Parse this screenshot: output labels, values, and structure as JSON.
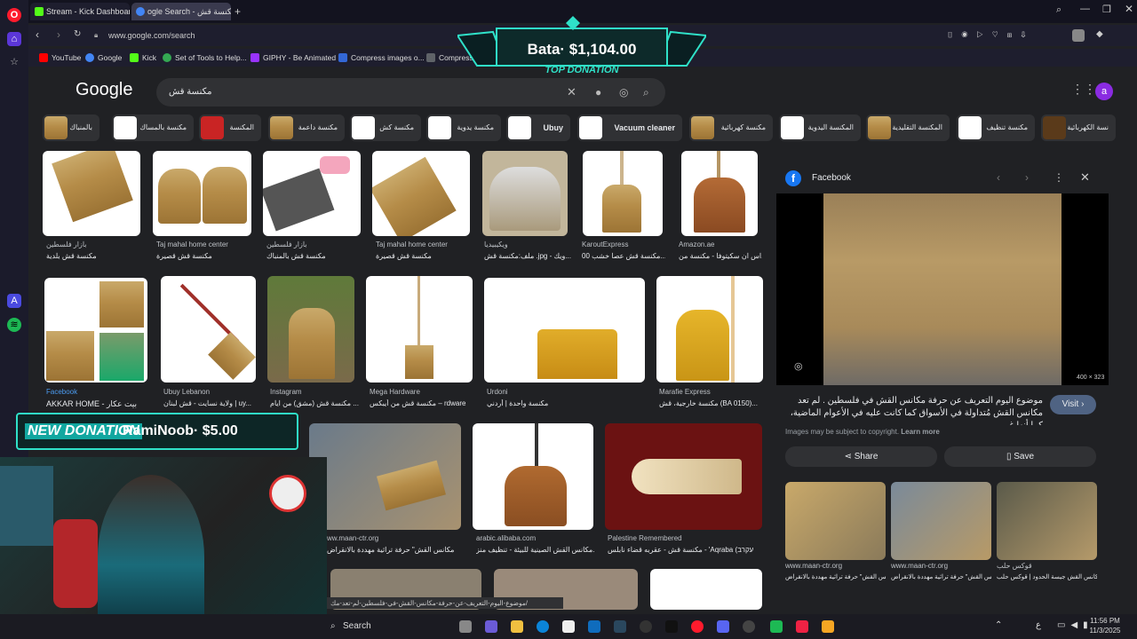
{
  "browser": {
    "tabs": [
      {
        "label": "Stream - Kick Dashboard",
        "color": "#53fc18"
      },
      {
        "label": "ogle Search - مكنسة قش",
        "color": "#4285f4"
      }
    ],
    "url": "www.google.com/search",
    "bookmarks": [
      {
        "label": "YouTube",
        "color": "#ff0000"
      },
      {
        "label": "Google",
        "color": "#4285f4"
      },
      {
        "label": "Kick",
        "color": "#53fc18"
      },
      {
        "label": "Set of Tools to Help...",
        "color": "#34a853"
      },
      {
        "label": "GIPHY - Be Animated",
        "color": "#9933ff"
      },
      {
        "label": "Compress images o...",
        "color": "#3367d6"
      },
      {
        "label": "Compress",
        "color": "#5f6368"
      }
    ]
  },
  "google": {
    "logo": "Google",
    "query": "مكنسة قش",
    "avatar": "a",
    "chips": [
      "بالمنباك",
      "مكنسة بالمساك",
      "المكنسة",
      "مكنسة داعمة",
      "مكنسة كش",
      "مكنسة يدوية",
      "Ubuy",
      "Vacuum cleaner",
      "مكنسة كهربائية",
      "المكنسة اليدوية",
      "المكنسة التقليدية",
      "مكنسة تنظيف",
      "نسة الكهربائية"
    ]
  },
  "results": {
    "row1": [
      {
        "source": "بازار فلسطين",
        "title": "مكنسة قش بلدية"
      },
      {
        "source": "Taj mahal home center",
        "title": "مكنسة قش قصيرة"
      },
      {
        "source": "بازار فلسطين",
        "title": "مكنسة قش بالمنباك"
      },
      {
        "source": "Taj mahal home center",
        "title": "مكنسة قش قصيرة"
      },
      {
        "source": "ويكيبيديا",
        "title": "ملف:مكنسة قش .jpg - ويك..."
      },
      {
        "source": "KaroutExpress",
        "title": "مكنسة قش عصا خشب 00..."
      },
      {
        "source": "Amazon.ae",
        "title": "اس ان سكيتوفا - مكنسة من..."
      }
    ],
    "row2": [
      {
        "source": "Facebook",
        "title": "AKKAR HOME - بيت عكار"
      },
      {
        "source": "Ubuy Lebanon",
        "title": "ولاية نسايت - قش لبنان | uy..."
      },
      {
        "source": "Instagram",
        "title": "مكنسة قش (مشق) من ايام ..."
      },
      {
        "source": "Mega Hardware",
        "title": "مكنسة قش من أيبكس – rdware"
      },
      {
        "source": "Urdoni",
        "title": "مكنسة واحدة | أردني"
      },
      {
        "source": "Marafie Express",
        "title": "مكنسة خارجية، قش (BA 0150)..."
      }
    ],
    "row3": [
      {
        "source": "ww.maan-ctr.org",
        "title": "مكانس القش\" حرفة تراثية مهددة بالانقراض"
      },
      {
        "source": "arabic.alibaba.com",
        "title": "مكانس القش الصينية للبيئة - تنظيف منز..."
      },
      {
        "source": "Palestine Remembered",
        "title": "مكنسة قش - عقربه قضاء نابلس - 'Aqraba (עקרב"
      }
    ],
    "status_url": "موضوع-اليوم-التعريف-عن-حرفة-مكانس-القش-في-فلسطين-لم-تعد-مك/"
  },
  "panel": {
    "source": "Facebook",
    "dims": "400 × 323",
    "title": "موضوع اليوم التعريف عن حرفة مكانس القش في فلسطين . لم تعد مكانس القش مُتداولة في الأسواق كما كانت عليه في الأعوام الماضية، كما أنها غير",
    "visit": "Visit",
    "copyright": "Images may be subject to copyright.",
    "learn_more": "Learn more",
    "share": "Share",
    "save": "Save",
    "related": [
      {
        "source": "www.maan-ctr.org",
        "title": "مكانس القش\" حرفة تراثية مهددة بالانقراض"
      },
      {
        "source": "www.maan-ctr.org",
        "title": "مكانس القش\" حرفة تراثية مهددة بالانقراض"
      },
      {
        "source": "قوكس حلب",
        "title": "مكانس القش جيسة الحدود | قوكس حلب"
      }
    ]
  },
  "overlays": {
    "top_donation_amount": "Bata· $1,104.00",
    "top_donation_label": "TOP DONATION",
    "new_donation_label": "NEW DONATION",
    "new_donation_value": "RamiNoob· $5.00"
  },
  "taskbar": {
    "search": "Search",
    "time": "11:56 PM",
    "date": "11/3/2025",
    "lang": "ع"
  }
}
